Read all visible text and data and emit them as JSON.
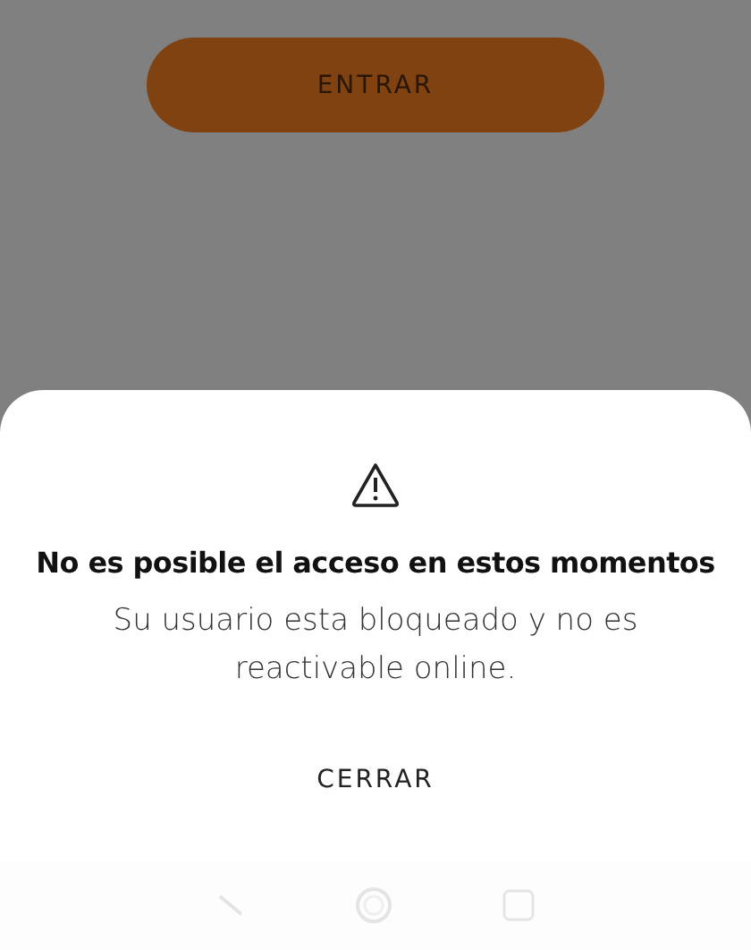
{
  "login_button": {
    "label": "ENTRAR"
  },
  "dialog": {
    "title": "No es posible el acceso en estos momentos",
    "message": "Su usuario esta bloqueado y no es reactivable online.",
    "button": "CERRAR"
  },
  "nav_bar": {
    "buttons": [
      {
        "kind": "back"
      },
      {
        "kind": "home"
      },
      {
        "kind": "recents"
      }
    ]
  }
}
